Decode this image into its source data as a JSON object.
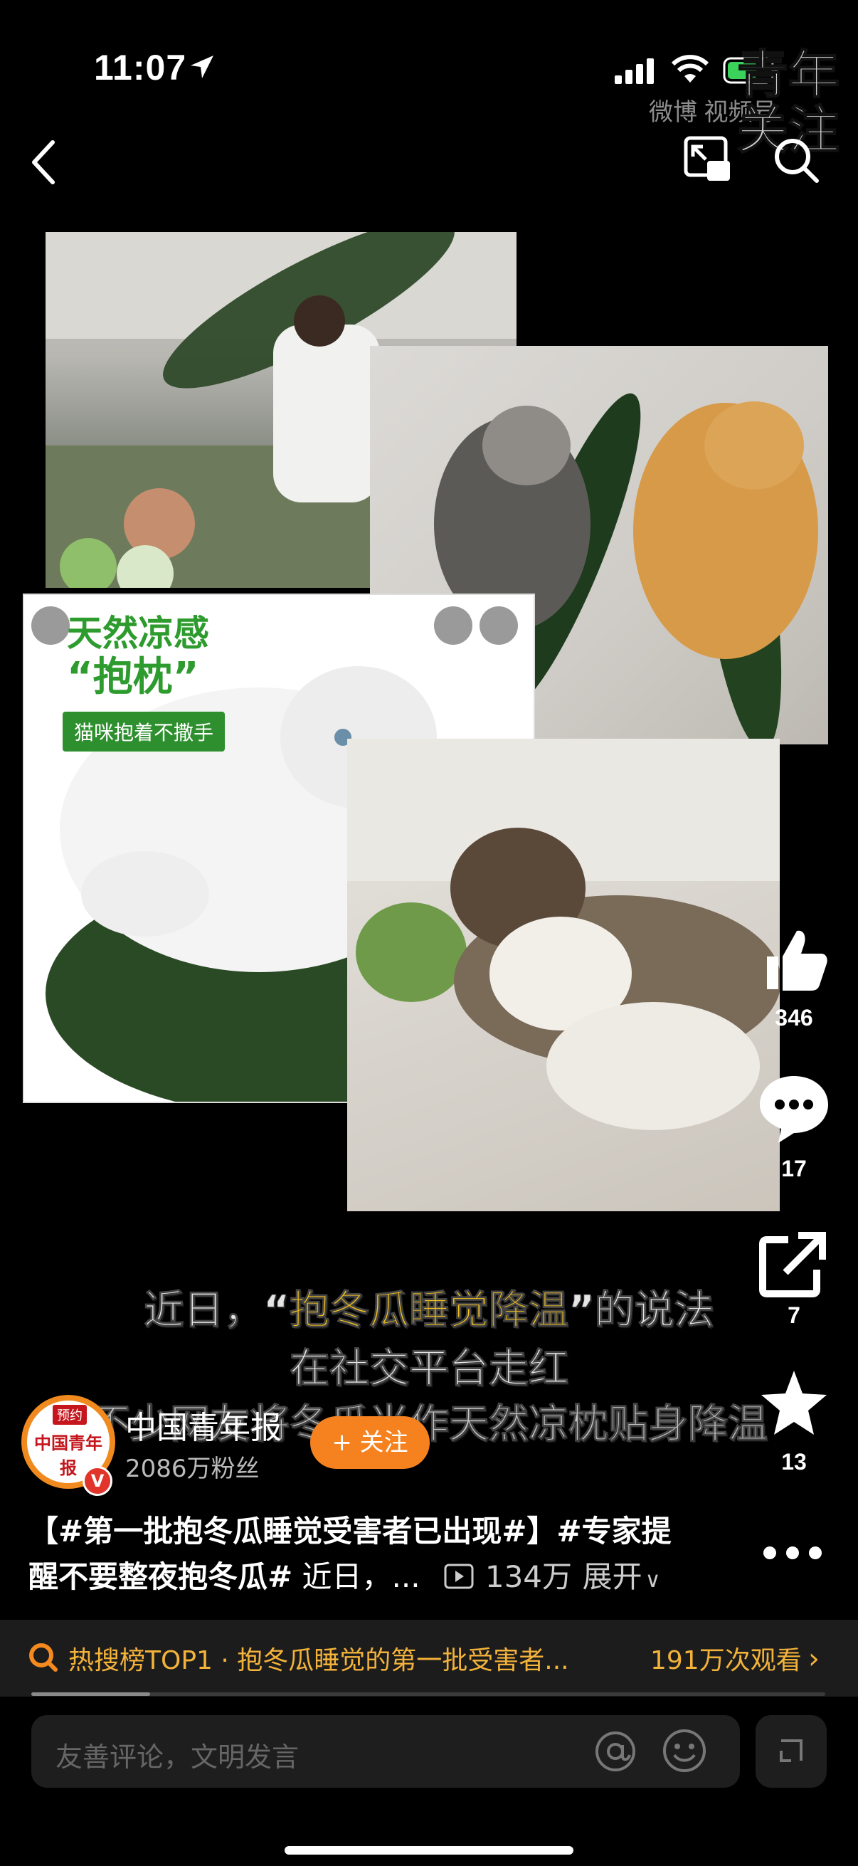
{
  "status_bar": {
    "time": "11:07"
  },
  "watermark": {
    "weibo": "微博 视频号",
    "tag": "青年\n关注"
  },
  "collage": {
    "ad_title": "天然凉感",
    "ad_subtitle": "“抱枕”",
    "ad_tag": "猫咪抱着不撒手"
  },
  "caption": {
    "line1_pre": "近日，“",
    "line1_highlight": "抱冬瓜睡觉降温",
    "line1_post": "”的说法",
    "line2": "在社交平台走红",
    "line3": "不少网友将冬瓜当作天然凉枕贴身降温"
  },
  "actions": {
    "likes": "346",
    "comments": "17",
    "shares": "7",
    "favorites": "13"
  },
  "author": {
    "name": "中国青年报",
    "fans": "2086万粉丝",
    "follow_label": "+ 关注",
    "avatar_badge": "预约",
    "avatar_logo": "中国青年报",
    "verified": "V"
  },
  "description": {
    "line1": "【#第一批抱冬瓜睡觉受害者已出现#】#专家提",
    "line2_bold": "醒不要整夜抱冬瓜#",
    "line2_plain": " 近日，...",
    "play_count": "134万",
    "expand": "展开"
  },
  "hot_search": {
    "text": "热搜榜TOP1 · 抱冬瓜睡觉的第一批受害者...",
    "views": "191万次观看"
  },
  "progress": {
    "fraction": 0.15
  },
  "comment_bar": {
    "placeholder": "友善评论，文明发言"
  },
  "colors": {
    "accent_orange": "#f5821f",
    "hot_gold": "#f3b23a",
    "caption_highlight": "#f4c21a"
  },
  "icons": [
    "location-arrow-icon",
    "signal-icon",
    "wifi-icon",
    "battery-icon",
    "back-icon",
    "pip-icon",
    "search-icon",
    "like-icon",
    "comment-icon",
    "share-icon",
    "favorite-icon",
    "more-icon",
    "hot-search-icon",
    "play-icon",
    "at-icon",
    "emoji-icon",
    "expand-icon"
  ]
}
